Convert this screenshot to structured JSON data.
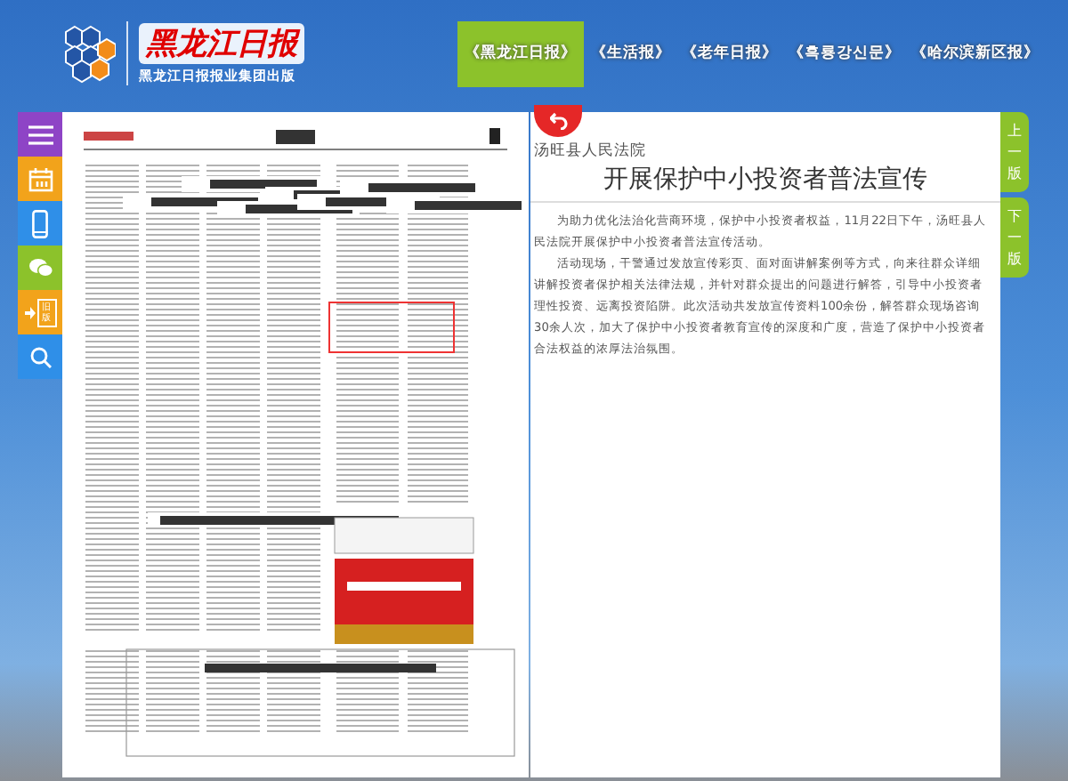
{
  "header": {
    "logo_title": "黑龙江日报",
    "logo_subtitle": "黑龙江日报报业集团出版"
  },
  "tabs": [
    {
      "label": "《黑龙江日报》",
      "selected": true
    },
    {
      "label": "《生活报》",
      "selected": false
    },
    {
      "label": "《老年日报》",
      "selected": false
    },
    {
      "label": "《흑룡강신문》",
      "selected": false
    },
    {
      "label": "《哈尔滨新区报》",
      "selected": false
    }
  ],
  "sidebar": [
    {
      "kind": "menu",
      "color": "#8e44c6"
    },
    {
      "kind": "calendar",
      "color": "#f2a31b"
    },
    {
      "kind": "phone",
      "color": "#2f8fe8"
    },
    {
      "kind": "wechat",
      "color": "#8cc22b"
    },
    {
      "kind": "old",
      "color": "#f2a31b",
      "label": "旧版"
    },
    {
      "kind": "search",
      "color": "#2f8fe8"
    }
  ],
  "article": {
    "source": "汤旺县人民法院",
    "title": "开展保护中小投资者普法宣传",
    "paragraphs": [
      "为助力优化法治化营商环境，保护中小投资者权益，11月22日下午，汤旺县人民法院开展保护中小投资者普法宣传活动。",
      "活动现场，干警通过发放宣传彩页、面对面讲解案例等方式，向来往群众详细讲解投资者保护相关法律法规，并针对群众提出的问题进行解答，引导中小投资者理性投资、远离投资陷阱。此次活动共发放宣传资料100余份，解答群众现场咨询30余人次，加大了保护中小投资者教育宣传的深度和广度，营造了保护中小投资者合法权益的浓厚法治氛围。"
    ]
  },
  "pager": [
    {
      "label": "上一版"
    },
    {
      "label": "下一版"
    }
  ]
}
